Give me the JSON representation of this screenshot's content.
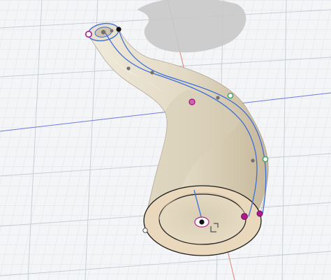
{
  "viewport": {
    "background": "#f4f5f7",
    "grid_minor_color": "#d9dde3",
    "grid_major_color": "#c2c8d1",
    "x_axis_color": "#6f7bdc",
    "y_axis_color": "#e08080"
  },
  "model": {
    "surface_color": "#e6dfcf",
    "surface_shade_color": "#c9bea7",
    "rim_color": "#e9d7bd",
    "inner_color": "#ddd2bb",
    "edge_color": "#1d1d1d",
    "shadow_color": "#c8c8c8"
  },
  "sketch": {
    "path_color": "#3e6fd8",
    "point_color": "#707070",
    "constraint_color": "#b1188e",
    "midpoint_color": "#3aa060",
    "endpoint_color": "#111111"
  },
  "icons": {
    "origin_marker": "origin-icon",
    "coincident_constraint": "constraint-glyph-icon"
  }
}
